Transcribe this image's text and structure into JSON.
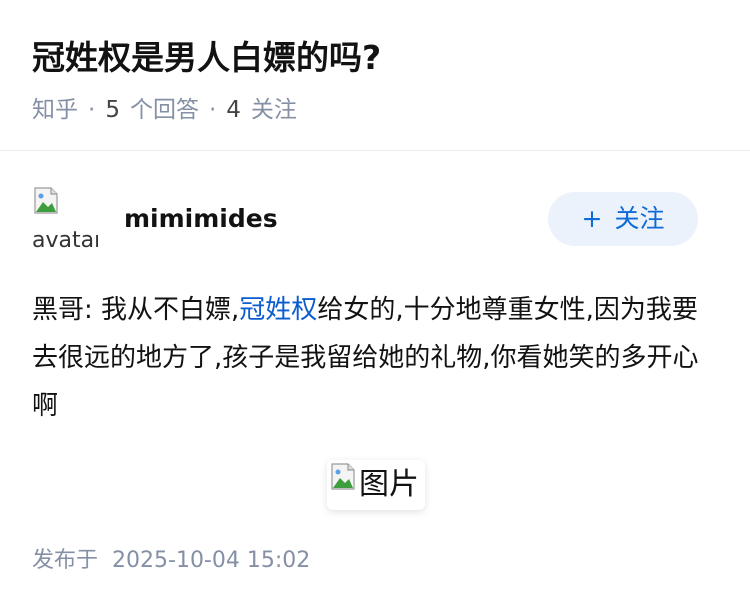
{
  "question": {
    "title": "冠姓权是男人白嫖的吗?",
    "source": "知乎",
    "separator": "·",
    "answer_count": "5",
    "answer_label": "个回答",
    "follower_count": "4",
    "follower_label": "关注"
  },
  "answer": {
    "avatar_alt": "avatar",
    "author_name": "mimimides",
    "follow_button": {
      "plus": "+",
      "label": "关注"
    },
    "content": {
      "before_link": "黑哥: 我从不白嫖,",
      "link_text": "冠姓权",
      "after_link": "给女的,十分地尊重女性,因为我要去很远的地方了,孩子是我留给她的礼物,你看她笑的多开心啊"
    },
    "image_alt": "图片",
    "published_label": "发布于",
    "published_time": "2025-10-04 15:02"
  },
  "colors": {
    "accent": "#0a5ccf",
    "meta_gray": "#8590a6",
    "follow_bg": "#ebf2fb"
  },
  "icons": {
    "broken_image": "broken-image-icon"
  }
}
